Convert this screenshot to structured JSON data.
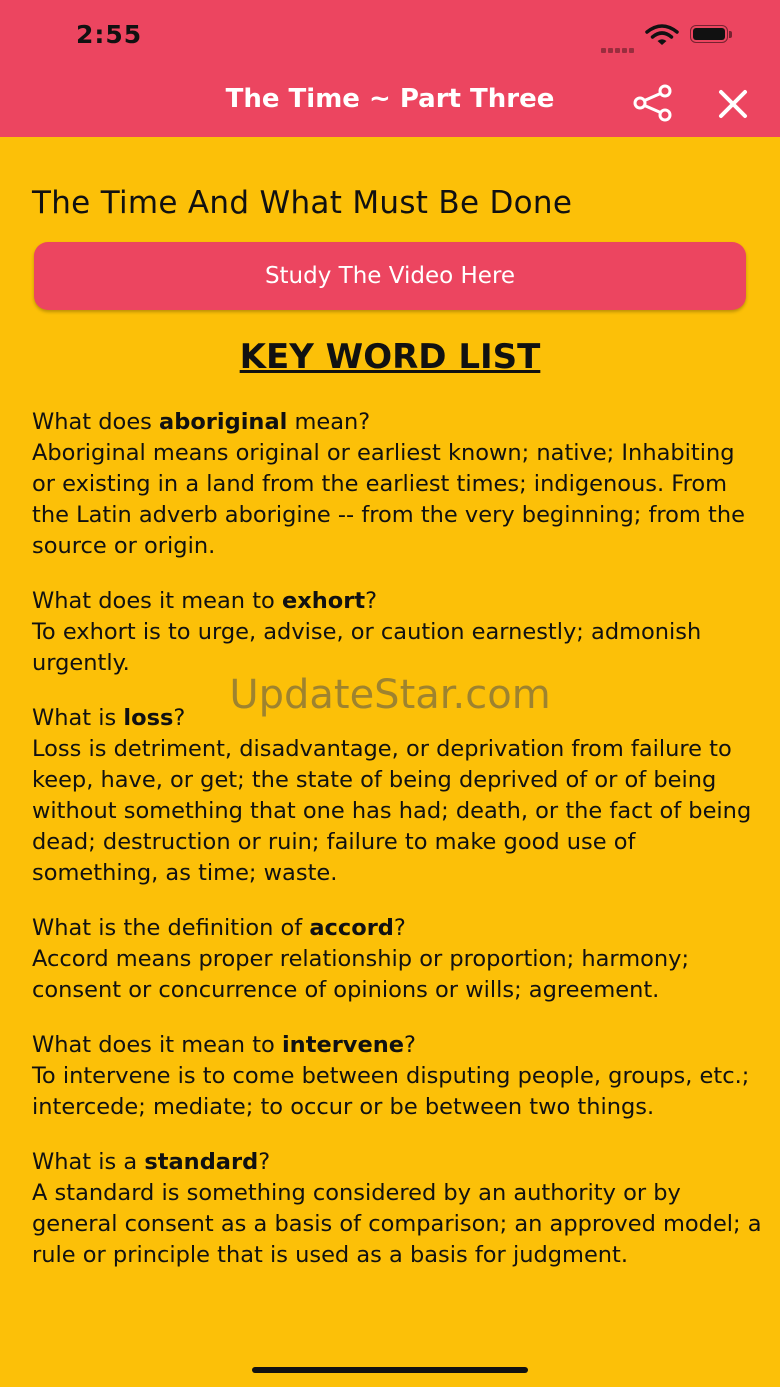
{
  "status_bar": {
    "time": "2:55"
  },
  "nav": {
    "title": "The Time ~ Part Three"
  },
  "heading": "The Time And What Must Be Done",
  "video_button_label": "Study The Video Here",
  "key_word_title": "KEY WORD LIST",
  "entries": [
    {
      "q_pre": "What does ",
      "word": "aboriginal",
      "q_post": " mean?",
      "definition": "Aboriginal means original or earliest known; native; Inhabiting or existing in a land from the earliest times; indigenous. From the Latin adverb aborigine -- from the very beginning; from the source or origin."
    },
    {
      "q_pre": "What does it mean to ",
      "word": "exhort",
      "q_post": "?",
      "definition": "To exhort is to urge, advise, or caution earnestly; admonish urgently."
    },
    {
      "q_pre": "What is ",
      "word": "loss",
      "q_post": "?",
      "definition": "Loss is detriment, disadvantage, or deprivation from failure to keep, have, or get; the state of being deprived of or of being without something that one has had; death, or the fact of being dead; destruction or ruin; failure to make good use of something, as time; waste."
    },
    {
      "q_pre": "What is the definition of ",
      "word": "accord",
      "q_post": "?",
      "definition": "Accord means proper relationship or proportion; harmony; consent or concurrence of opinions or wills; agreement."
    },
    {
      "q_pre": "What does it mean to ",
      "word": "intervene",
      "q_post": "?",
      "definition": "To intervene is to come between disputing people, groups, etc.; intercede; mediate; to occur or be between two things."
    },
    {
      "q_pre": "What is a ",
      "word": "standard",
      "q_post": "?",
      "definition": "A standard is something considered by an authority or by general consent as a basis of comparison; an approved model; a rule or principle that is used as a basis for judgment."
    }
  ],
  "watermark": "UpdateStar.com",
  "icons": {
    "share": "share-icon",
    "close": "close-icon",
    "wifi": "wifi-icon",
    "battery": "battery-icon",
    "signal": "signal-icon"
  },
  "colors": {
    "header": "#EC4560",
    "background": "#FCC008",
    "button": "#EC4560"
  }
}
